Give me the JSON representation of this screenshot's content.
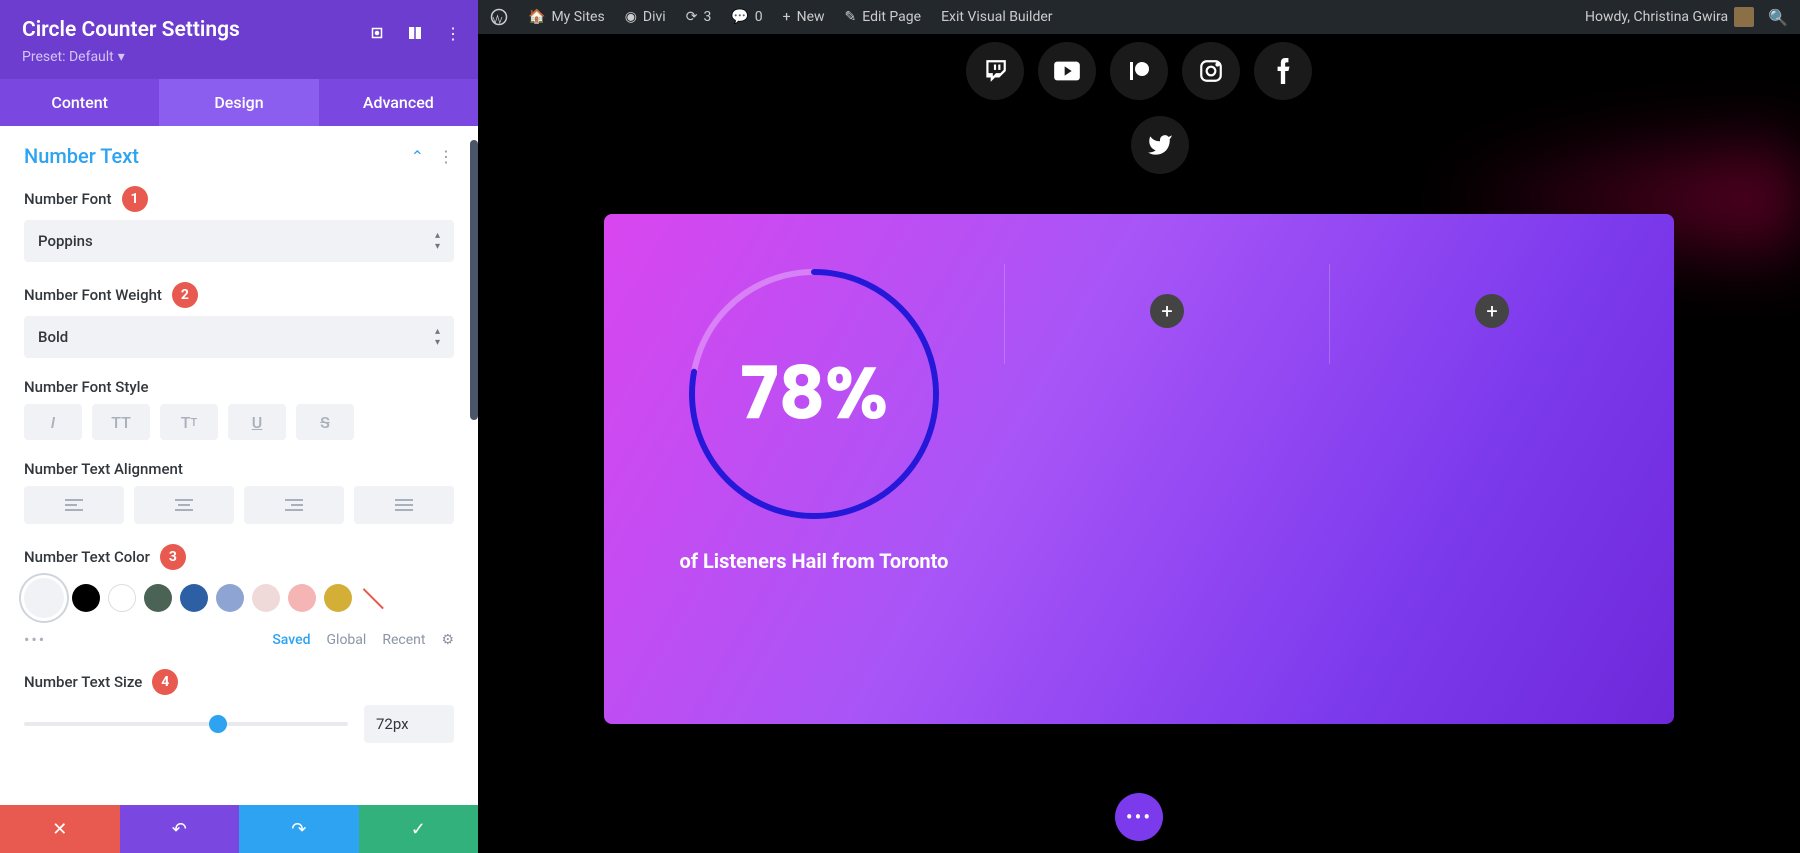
{
  "panel": {
    "title": "Circle Counter Settings",
    "preset": "Preset: Default",
    "tabs": [
      "Content",
      "Design",
      "Advanced"
    ],
    "activeTab": 1
  },
  "section": {
    "title": "Number Text"
  },
  "fields": {
    "numberFont": {
      "label": "Number Font",
      "value": "Poppins",
      "annotation": "1"
    },
    "numberFontWeight": {
      "label": "Number Font Weight",
      "value": "Bold",
      "annotation": "2"
    },
    "numberFontStyle": {
      "label": "Number Font Style"
    },
    "numberTextAlignment": {
      "label": "Number Text Alignment"
    },
    "numberTextColor": {
      "label": "Number Text Color",
      "annotation": "3"
    },
    "numberTextSize": {
      "label": "Number Text Size",
      "value": "72px",
      "annotation": "4"
    }
  },
  "colorSwatches": [
    {
      "bg": "#f0f2f5",
      "selected": true
    },
    {
      "bg": "#000000"
    },
    {
      "bg": "#ffffff",
      "border": true
    },
    {
      "bg": "#4a6355"
    },
    {
      "bg": "#2d5fa5"
    },
    {
      "bg": "#8ea4d2"
    },
    {
      "bg": "#f0d9d9"
    },
    {
      "bg": "#f5b5b5"
    },
    {
      "bg": "#d4af37"
    },
    {
      "bg": "transparent"
    }
  ],
  "colorTabs": {
    "saved": "Saved",
    "global": "Global",
    "recent": "Recent"
  },
  "adminBar": {
    "mySites": "My Sites",
    "divi": "Divi",
    "updates": "3",
    "comments": "0",
    "new": "New",
    "editPage": "Edit Page",
    "exitBuilder": "Exit Visual Builder",
    "greeting": "Howdy, Christina Gwira"
  },
  "preview": {
    "counterValue": "78%",
    "counterPercent": 78,
    "caption": "of Listeners Hail from Toronto"
  }
}
